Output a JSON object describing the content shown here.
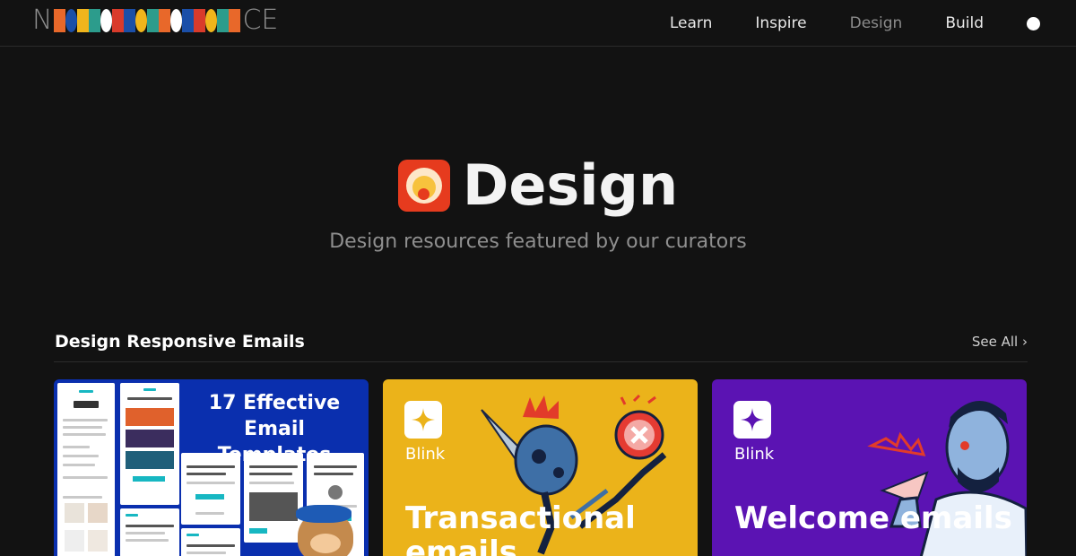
{
  "brand": {
    "logo_start": "N",
    "logo_end": "CE",
    "tiles": [
      "#e8682a",
      "#1b4fa8",
      "#f0b51c",
      "#2c9c8c",
      "#ffffff",
      "#d93b2b",
      "#1b4fa8",
      "#f0b51c",
      "#2c9c8c",
      "#e8682a",
      "#ffffff",
      "#1b4fa8",
      "#d93b2b",
      "#f0b51c",
      "#2c9c8c",
      "#e8682a"
    ]
  },
  "nav": {
    "items": [
      {
        "label": "Learn",
        "active": false
      },
      {
        "label": "Inspire",
        "active": false
      },
      {
        "label": "Design",
        "active": true
      },
      {
        "label": "Build",
        "active": false
      }
    ]
  },
  "hero": {
    "title": "Design",
    "subtitle": "Design resources featured by our curators"
  },
  "section": {
    "title": "Design Responsive Emails",
    "see_all": "See All",
    "chevron": "›"
  },
  "cards": [
    {
      "style": "blue",
      "title_line1": "17 Effective Email",
      "title_line2": "Templates"
    },
    {
      "style": "yellow",
      "brand": "Blink",
      "title": "Transactional emails"
    },
    {
      "style": "purple",
      "brand": "Blink",
      "title": "Welcome emails"
    }
  ],
  "colors": {
    "background": "#121212",
    "card_blue": "#0a2fae",
    "card_yellow": "#ebb31a",
    "card_purple": "#5b13b3",
    "design_icon": "#e63b1e"
  }
}
